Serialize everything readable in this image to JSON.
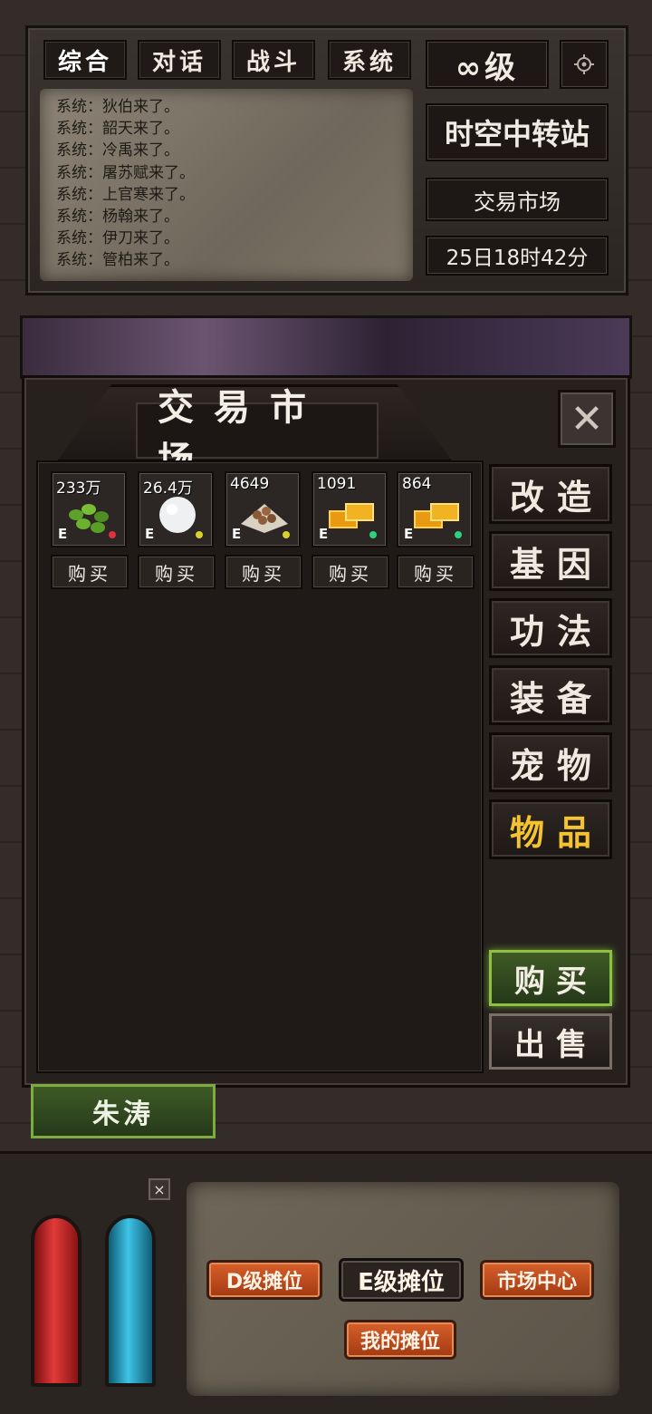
{
  "top": {
    "tabs": [
      {
        "label": "综合"
      },
      {
        "label": "对话"
      },
      {
        "label": "战斗"
      },
      {
        "label": "系统"
      }
    ],
    "level": "∞级",
    "location": "时空中转站",
    "sublocation": "交易市场",
    "time": "25日18时42分",
    "chat_lines": [
      "系统：狄伯来了。",
      "系统：韶天来了。",
      "系统：冷禹来了。",
      "系统：屠苏赋来了。",
      "系统：上官寒来了。",
      "系统：杨翰来了。",
      "系统：伊刀来了。",
      "系统：管柏来了。"
    ]
  },
  "market": {
    "title": "交易市场",
    "items": [
      {
        "qty": "233万",
        "grade": "E",
        "dot_color": "#e0323a",
        "art": "beans"
      },
      {
        "qty": "26.4万",
        "grade": "E",
        "dot_color": "#d9d22a",
        "art": "pearl"
      },
      {
        "qty": "4649",
        "grade": "E",
        "dot_color": "#d9d22a",
        "art": "seeds"
      },
      {
        "qty": "1091",
        "grade": "E",
        "dot_color": "#2fd17a",
        "art": "gold-bars"
      },
      {
        "qty": "864",
        "grade": "E",
        "dot_color": "#2fd17a",
        "art": "gold-bars"
      }
    ],
    "buy_label": "购买",
    "categories": [
      {
        "label": "改造"
      },
      {
        "label": "基因"
      },
      {
        "label": "功法"
      },
      {
        "label": "装备"
      },
      {
        "label": "宠物"
      },
      {
        "label": "物品",
        "selected": true
      }
    ],
    "action_buy": "购买",
    "action_sell": "出售"
  },
  "npc": {
    "name": "朱涛"
  },
  "bottom": {
    "close": "×",
    "stalls": {
      "d": "D级摊位",
      "e": "E级摊位",
      "center": "市场中心",
      "mine": "我的摊位"
    }
  },
  "colors": {
    "selected_category": "#f5c230",
    "buy_green": "#8fbf43"
  }
}
